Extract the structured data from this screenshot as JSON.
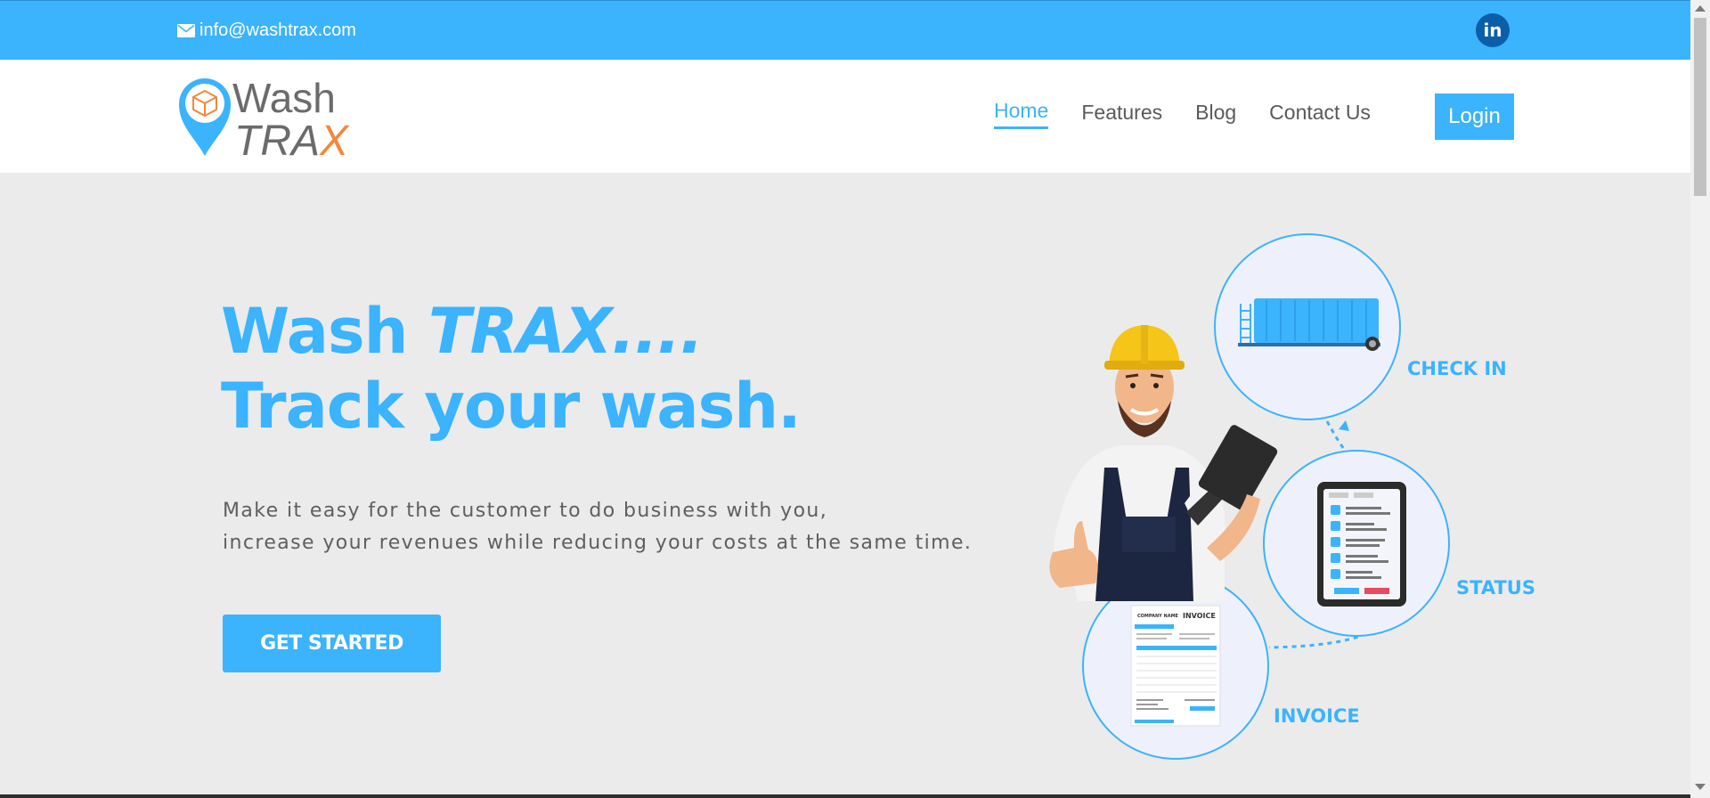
{
  "topbar": {
    "email": "info@washtrax.com",
    "email_icon": "envelope-icon",
    "social_icon": "linkedin-icon",
    "social_label": "in"
  },
  "logo": {
    "wash": "Wash",
    "tra": "TRA",
    "x": "X"
  },
  "nav": {
    "items": [
      {
        "label": "Home",
        "active": true
      },
      {
        "label": "Features",
        "active": false
      },
      {
        "label": "Blog",
        "active": false
      },
      {
        "label": "Contact Us",
        "active": false
      }
    ],
    "login_label": "Login"
  },
  "hero": {
    "title_wash": "Wash",
    "title_trax": "TRAX....",
    "title_line2": "Track your wash.",
    "text_line1": "Make it easy for the customer to do business with you,",
    "text_line2": "increase your revenues while reducing your costs at the same time.",
    "cta_label": "GET STARTED"
  },
  "illustration": {
    "steps": [
      "CHECK IN",
      "STATUS",
      "INVOICE"
    ],
    "invoice_doc": {
      "company": "COMPANY NAME",
      "title": "INVOICE"
    }
  },
  "colors": {
    "primary": "#3bb3fd",
    "accent": "#f5873a",
    "text": "#5f5f5f",
    "background": "#ebebeb"
  }
}
